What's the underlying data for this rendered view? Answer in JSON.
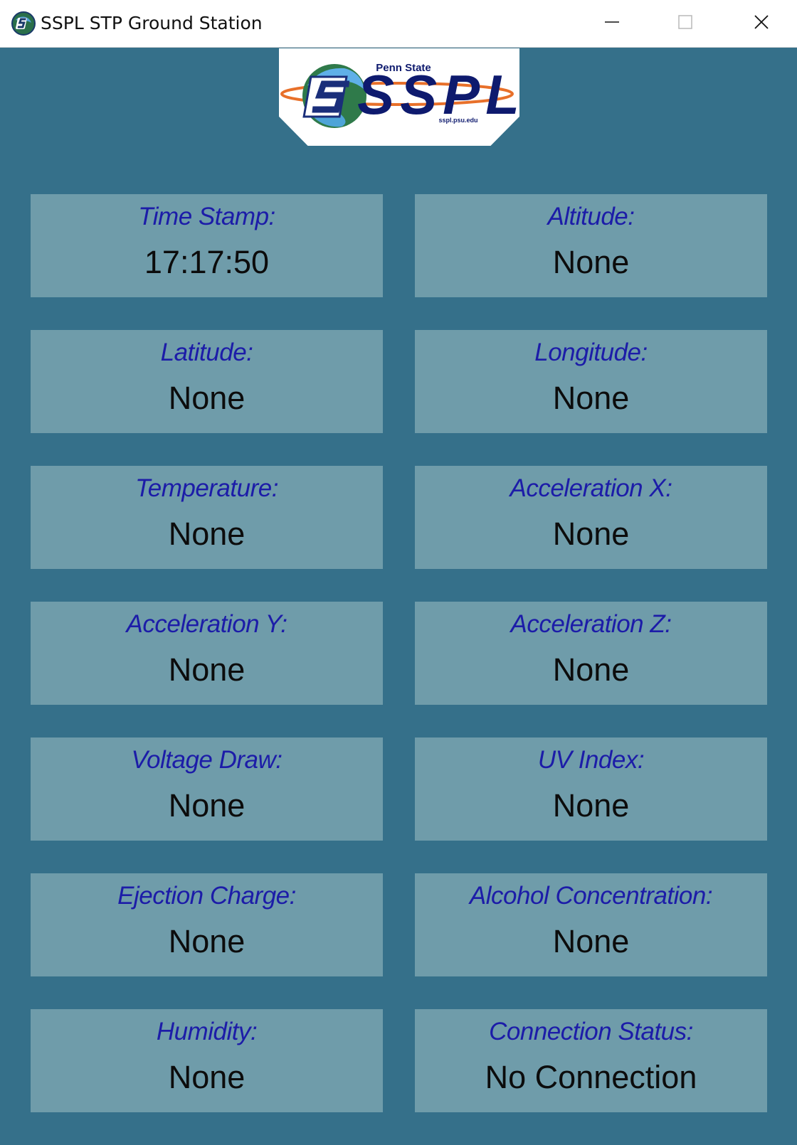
{
  "window": {
    "title": "SSPL STP Ground Station",
    "icon": "sspl-app-icon",
    "controls": [
      "minimize-icon",
      "maximize-icon",
      "close-icon"
    ]
  },
  "logo": {
    "top_text": "Penn State",
    "main_text": "SSPL",
    "url_text": "sspl.psu.edu"
  },
  "fields": [
    {
      "label": "Time Stamp:",
      "value": "17:17:50"
    },
    {
      "label": "Altitude:",
      "value": "None"
    },
    {
      "label": "Latitude:",
      "value": "None"
    },
    {
      "label": "Longitude:",
      "value": "None"
    },
    {
      "label": "Temperature:",
      "value": "None"
    },
    {
      "label": "Acceleration X:",
      "value": "None"
    },
    {
      "label": "Acceleration Y:",
      "value": "None"
    },
    {
      "label": "Acceleration Z:",
      "value": "None"
    },
    {
      "label": "Voltage Draw:",
      "value": "None"
    },
    {
      "label": "UV Index:",
      "value": "None"
    },
    {
      "label": "Ejection Charge:",
      "value": "None"
    },
    {
      "label": "Alcohol Concentration:",
      "value": "None"
    },
    {
      "label": "Humidity:",
      "value": "None"
    },
    {
      "label": "Connection Status:",
      "value": "No Connection"
    }
  ],
  "colors": {
    "background": "#35708a",
    "tile": "#6f9caa",
    "label": "#1c1ca8",
    "value": "#0c0c0c"
  }
}
